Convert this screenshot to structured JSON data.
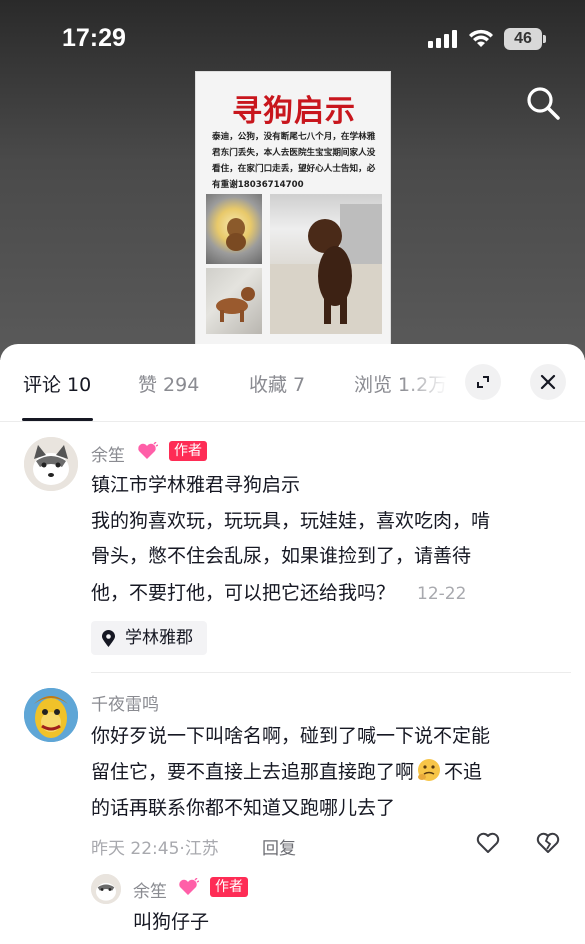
{
  "status_bar": {
    "time": "17:29",
    "battery": "46"
  },
  "poster": {
    "title": "寻狗启示",
    "text": "泰迪，公狗，没有断尾七八个月，在学林雅君东门丢失，本人去医院生宝宝期间家人没看住，在家门口走丢，望好心人士告知，必有重谢18036714700"
  },
  "tabs": [
    {
      "label": "评论 10"
    },
    {
      "label": "赞 294"
    },
    {
      "label": "收藏 7"
    },
    {
      "label": "浏览 1.2万"
    }
  ],
  "comments": [
    {
      "username": "余笙",
      "tag": "作者",
      "title": "镇江市学林雅君寻狗启示",
      "body_line1": "我的狗喜欢玩，玩玩具，玩娃娃，喜欢吃肉，啃",
      "body_line2": "骨头，憋不住会乱尿，如果谁捡到了，请善待",
      "body_line3": "他，不要打他，可以把它还给我吗？",
      "date": "12-22",
      "location": "学林雅郡"
    },
    {
      "username": "千夜雷鸣",
      "body_line1": "你好歹说一下叫啥名啊，碰到了喊一下说不定能",
      "body_line2": "留住它，要不直接上去追那直接跑了啊",
      "body_line2_tail": "不追",
      "body_line3": "的话再联系你都不知道又跑哪儿去了",
      "time": "昨天 22:45",
      "region": "江苏",
      "reply_label": "回复"
    }
  ],
  "reply": {
    "username": "余笙",
    "tag": "作者",
    "body": "叫狗仔子"
  },
  "colors": {
    "author_tag": "#fe2c55",
    "poster_title": "#c8161d"
  }
}
